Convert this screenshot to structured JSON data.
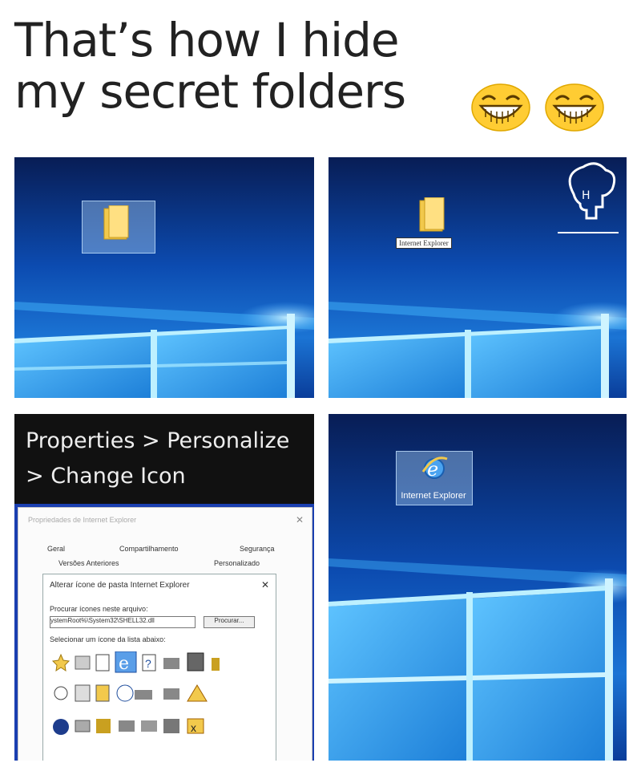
{
  "caption": {
    "line1": "That’s how I hide",
    "line2": "my secret folders"
  },
  "emoji": "laughing-with-tears",
  "panel_top_right": {
    "rename_text": "Internet Explorer"
  },
  "panel_bottom_left": {
    "header_line1": "Properties > Personalize",
    "header_line2": "> Change Icon",
    "dialog": {
      "title": "Propriedades de Internet Explorer",
      "close_glyph": "✕",
      "tabs_row1": [
        "Geral",
        "Compartilhamento",
        "Segurança"
      ],
      "tabs_row2": [
        "Versões Anteriores",
        "Personalizado"
      ],
      "inner_title": "Alterar ícone de pasta Internet Explorer",
      "inner_close_glyph": "✕",
      "search_label": "Procurar ícones neste arquivo:",
      "path_value": "ystemRoot%\\System32\\SHELL32.dll",
      "browse_label": "Procurar...",
      "select_label": "Selecionar um ícone da lista abaixo:",
      "question_glyph": "?"
    }
  },
  "panel_bottom_right": {
    "icon_label": "Internet Explorer"
  },
  "colors": {
    "desktop_dark": "#0a2a6b",
    "desktop_mid": "#0d4aa6",
    "desktop_light": "#2e8fe0",
    "window_glow": "#8fe0ff",
    "folder_yellow": "#f2c94c",
    "header_bg": "#111111",
    "emoji_yellow": "#ffcc33"
  }
}
